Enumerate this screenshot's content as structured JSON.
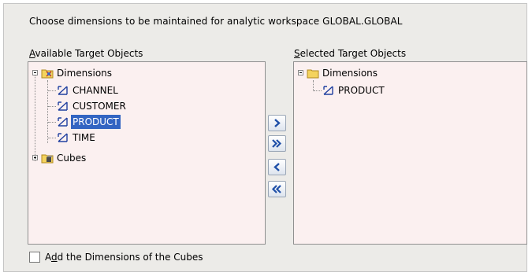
{
  "instruction": "Choose dimensions to be maintained for analytic workspace GLOBAL.GLOBAL",
  "available": {
    "label_prefix": "",
    "label_mnemonic": "A",
    "label_rest": "vailable Target Objects",
    "tree": {
      "dimensions_label": "Dimensions",
      "dimensions": [
        "CHANNEL",
        "CUSTOMER",
        "PRODUCT",
        "TIME"
      ],
      "selected_item": "PRODUCT",
      "cubes_label": "Cubes"
    }
  },
  "selected": {
    "label_mnemonic": "S",
    "label_rest": "elected Target Objects",
    "tree": {
      "dimensions_label": "Dimensions",
      "dimensions": [
        "PRODUCT"
      ]
    }
  },
  "buttons": {
    "add": "add-selected",
    "add_all": "add-all",
    "remove": "remove-selected",
    "remove_all": "remove-all"
  },
  "checkbox": {
    "label_prefix": "A",
    "label_mnemonic": "d",
    "label_rest": "d the Dimensions of the Cubes",
    "checked": false
  },
  "colors": {
    "panel_bg": "#fbf0f0",
    "selection": "#3365c2",
    "dialog_bg": "#ecebe8"
  }
}
